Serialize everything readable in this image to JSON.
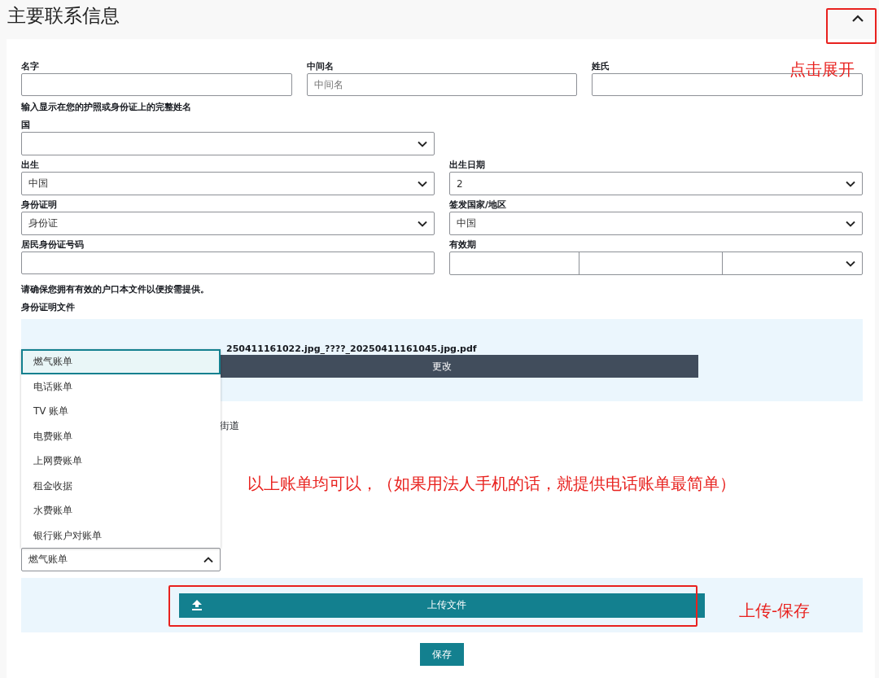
{
  "title": "主要联系信息",
  "collapse": {
    "expanded": true
  },
  "name_row": [
    {
      "label": "名字"
    },
    {
      "label": "中间名",
      "placeholder": "中间名"
    },
    {
      "label": "姓氏"
    }
  ],
  "name_hint": "输入显示在您的护照或身份证上的完整姓名",
  "nationality": {
    "label": "国"
  },
  "pairs": [
    [
      {
        "label": "出生",
        "value": "中国"
      },
      {
        "label": "出生日期",
        "value": "2"
      }
    ],
    [
      {
        "label": "身份证明",
        "value": "身份证"
      },
      {
        "label": "签发国家/地区",
        "value": "中国"
      }
    ]
  ],
  "id_number": {
    "label": "居民身份证号码"
  },
  "expiry": {
    "label": "有效期"
  },
  "household_note": "请确保您拥有有效的户口本文件以便按需提供。",
  "id_doc": {
    "label": "身份证明文件",
    "filename": "250411161022.jpg_????_20250411161045.jpg.pdf",
    "button": "更改"
  },
  "address_fragment": "街道",
  "bill_select": {
    "value": "燃气账单",
    "expanded": true,
    "options": [
      {
        "label": "燃气账单",
        "selected": true
      },
      {
        "label": "电话账单",
        "selected": false
      },
      {
        "label": "TV 账单",
        "selected": false
      },
      {
        "label": "电费账单",
        "selected": false
      },
      {
        "label": "上网费账单",
        "selected": false
      },
      {
        "label": "租金收据",
        "selected": false
      },
      {
        "label": "水费账单",
        "selected": false
      },
      {
        "label": "银行账户对账单",
        "selected": false
      }
    ]
  },
  "upload_button": "上传文件",
  "save_button": "保存",
  "annotations": [
    {
      "kind": "expand",
      "text": "点击展开"
    },
    {
      "kind": "note",
      "text": "以上账单均可以，（如果用法人手机的话，就提供电话账单最简单）"
    },
    {
      "kind": "upload",
      "text": "上传-保存"
    }
  ]
}
